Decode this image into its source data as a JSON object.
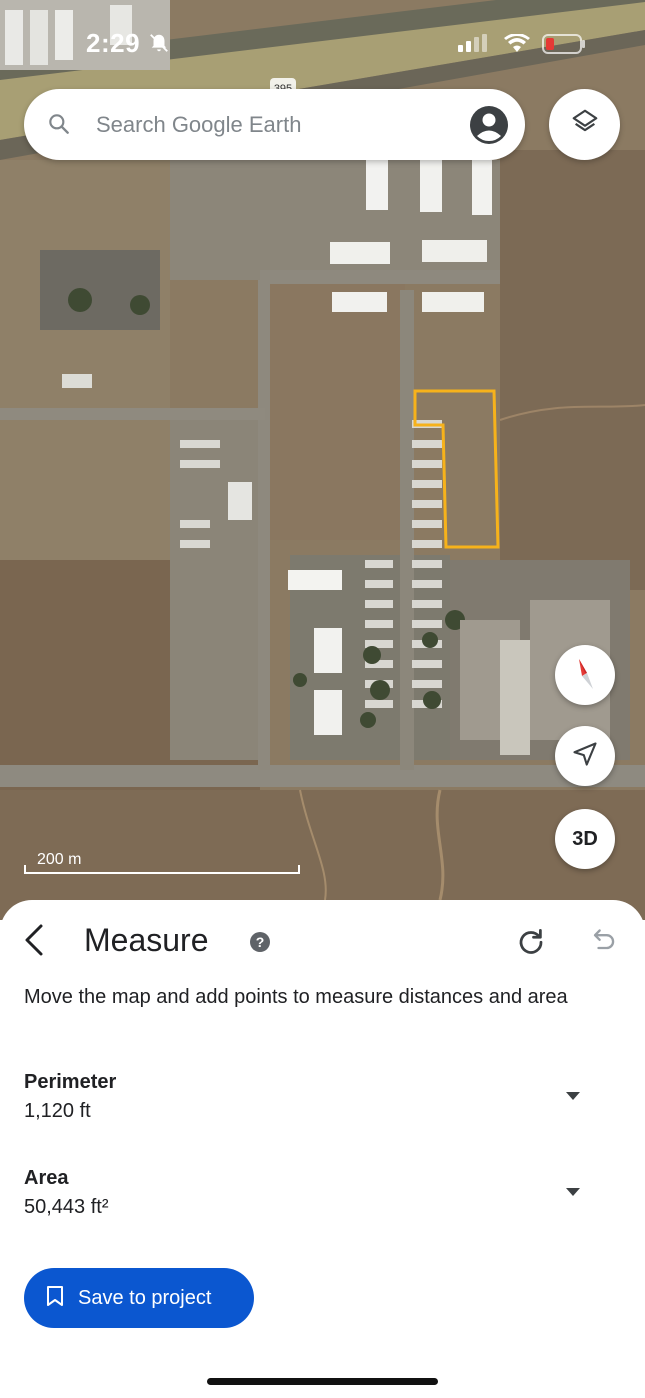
{
  "status_bar": {
    "time": "2:29"
  },
  "search": {
    "placeholder": "Search Google Earth"
  },
  "map": {
    "scale_label": "200 m",
    "three_d_label": "3D",
    "highway_shield": "395"
  },
  "measure": {
    "title": "Measure",
    "instructions": "Move the map and add points to measure distances and area",
    "perimeter_label": "Perimeter",
    "perimeter_value": "1,120 ft",
    "area_label": "Area",
    "area_value": "50,443 ft²",
    "save_label": "Save to project"
  },
  "colors": {
    "accent": "#0b57d0",
    "polygon": "#f6b21b",
    "compass_red": "#e53935"
  },
  "icons": {
    "search": "search-icon",
    "account": "account-icon",
    "layers": "layers-icon",
    "compass": "compass-icon",
    "location": "navigation-arrow-icon",
    "back": "back-arrow-icon",
    "help": "help-icon",
    "redo": "redo-icon",
    "undo": "undo-icon",
    "dropdown": "dropdown-arrow-icon",
    "bookmark": "bookmark-icon"
  }
}
